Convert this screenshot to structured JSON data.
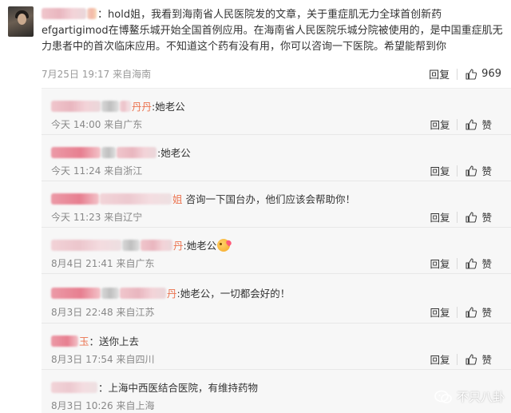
{
  "main_comment": {
    "user_tail": "：",
    "text": "hold姐，我看到海南省人民医院发的文章，关于重症肌无力全球首创新药efgartigimod在博鳌乐城开始全国首例应用。在海南省人民医院乐城分院被使用的，是中国重症肌无力患者中的首次临床应用。不知道这个药有没有用，你可以咨询一下医院。希望能帮到你",
    "time": "7月25日 19:17",
    "location": "来自海南",
    "reply_label": "回复",
    "likes": "969"
  },
  "replies": [
    {
      "name_tail": "丹丹",
      "text": ":她老公",
      "time": "今天 14:00",
      "location": "来自广东",
      "reply_label": "回复",
      "like_label": "赞",
      "emoji": false
    },
    {
      "name_tail": "",
      "text": ":她老公",
      "time": "今天 11:24",
      "location": "来自浙江",
      "reply_label": "回复",
      "like_label": "赞",
      "emoji": false
    },
    {
      "name_tail": "姐",
      "text": " 咨询一下国台办，他们应该会帮助你！",
      "time": "今天 11:23",
      "location": "来自辽宁",
      "reply_label": "回复",
      "like_label": "赞",
      "emoji": false
    },
    {
      "name_tail": "丹",
      "text": ":她老公",
      "time": "8月4日 21:41",
      "location": "来自广东",
      "reply_label": "回复",
      "like_label": "赞",
      "emoji": true
    },
    {
      "name_tail": "丹",
      "text": ":她老公，一切都会好的！",
      "time": "8月3日 22:48",
      "location": "来自江苏",
      "reply_label": "回复",
      "like_label": "赞",
      "emoji": false
    },
    {
      "name_tail": "玉",
      "text": "：送你上去",
      "time": "8月3日 17:54",
      "location": "来自四川",
      "reply_label": "回复",
      "like_label": "赞",
      "emoji": false
    },
    {
      "name_tail": "",
      "text": "：上海中西医结合医院，有维持药物",
      "time": "8月3日 10:26",
      "location": "来自上海",
      "reply_label": "回复",
      "like_label": "赞",
      "emoji": false
    }
  ],
  "watermark": {
    "text": "不只八卦"
  },
  "colors": {
    "meta": "#888888",
    "subbox_bg": "#f7f7f7",
    "text": "#333333"
  }
}
